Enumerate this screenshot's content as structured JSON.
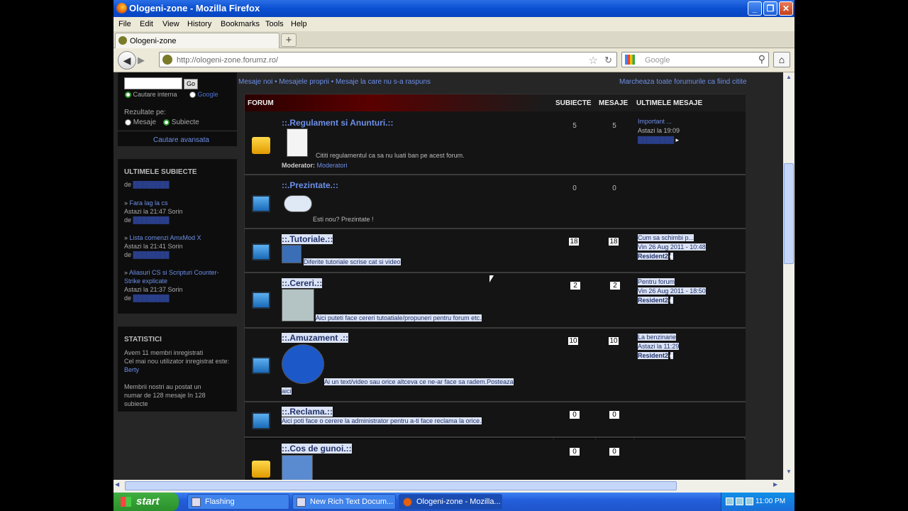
{
  "window": {
    "title": "Ologeni-zone - Mozilla Firefox"
  },
  "menu": [
    "File",
    "Edit",
    "View",
    "History",
    "Bookmarks",
    "Tools",
    "Help"
  ],
  "tab": {
    "label": "Ologeni-zone"
  },
  "address": {
    "url": "http://ologeni-zone.forumz.ro/"
  },
  "search": {
    "placeholder": "Google"
  },
  "sidebar": {
    "search_go": "Go",
    "radio_intern": "Cautare interna",
    "radio_google": "Google",
    "results_label": "Rezultate pe:",
    "radio_mesaje": "Mesaje",
    "radio_subiecte": "Subiecte",
    "advanced": "Cautare avansata",
    "latest_title": "ULTIMELE SUBIECTE",
    "de": "de",
    "topics": [
      {
        "title": "Fara lag la cs",
        "time": "Astazi la 21:47 Sorin",
        "by": "de"
      },
      {
        "title": "Lista comenzi AmxMod X",
        "time": "Astazi la 21:41 Sorin",
        "by": "de"
      },
      {
        "title": "Aliasuri CS si Scripturi Counter-Strike explicate",
        "time": "Astazi la 21:37 Sorin",
        "by": "de"
      }
    ],
    "stats_title": "STATISTICI",
    "stats_line1": "Avem 11 membri inregistrati",
    "stats_line2": "Cel mai nou utilizator inregistrat este:",
    "stats_user": "Berty",
    "stats_line3": "Membrii nostri au postat un numar de 128 mesaje în 128 subiecte"
  },
  "toplinks": {
    "left": "Mesaje noi • Mesajele proprii • Mesaje la care nu s-a raspuns",
    "right": "Marcheaza toate forumurile ca fiind citite"
  },
  "forum": {
    "headers": {
      "forum": "FORUM",
      "subiecte": "SUBIECTE",
      "mesaje": "MESAJE",
      "ultimele": "ULTIMELE MESAJE"
    },
    "rows": [
      {
        "title": "::.Regulament si Anunturi.::",
        "desc": "Cititi regulamentul ca sa nu luati ban pe acest forum.",
        "mod_label": "Moderator:",
        "mod": "Moderatori",
        "subiecte": "5",
        "mesaje": "5",
        "last_title": "Important ...",
        "last_date": "Astazi la 19:09",
        "last_user": ""
      },
      {
        "title": "::.Prezintate.::",
        "desc": "Esti nou? Prezintate !",
        "subiecte": "0",
        "mesaje": "0"
      },
      {
        "title": "::.Tutoriale.::",
        "desc": "Diferite tutoriale scrise cat si video",
        "subiecte": "18",
        "mesaje": "18",
        "last_title": "Cum sa schimbi p...",
        "last_date": "Vin 26 Aug 2011 - 10:48",
        "last_user": "Resident2"
      },
      {
        "title": "::.Cereri.::",
        "desc": "Aici puteti face cereri tutoatiale/propuneri pentru forum etc.",
        "subiecte": "2",
        "mesaje": "2",
        "last_title": "Pentru forum",
        "last_date": "Vin 26 Aug 2011 - 18:50",
        "last_user": "Resident2"
      },
      {
        "title": "::.Amuzament .::",
        "desc": "Ai un text/video sau orice altceva ce ne-ar face sa radem.Posteaza",
        "desc2": "aici",
        "subiecte": "10",
        "mesaje": "10",
        "last_title": "La benzinarie",
        "last_date": "Astazi la 11:29",
        "last_user": "Resident2"
      },
      {
        "title": "::.Reclama.::",
        "desc": "Aici poti face o cerere la administrator pentru a-ti face reclama la orice.",
        "subiecte": "0",
        "mesaje": "0"
      },
      {
        "title": "::.Cos de gunoi.::",
        "subiecte": "0",
        "mesaje": "0"
      }
    ]
  },
  "taskbar": {
    "start": "start",
    "items": [
      "Flashing",
      "New Rich Text Docum...",
      "Ologeni-zone - Mozilla..."
    ],
    "clock": "11:00 PM"
  }
}
